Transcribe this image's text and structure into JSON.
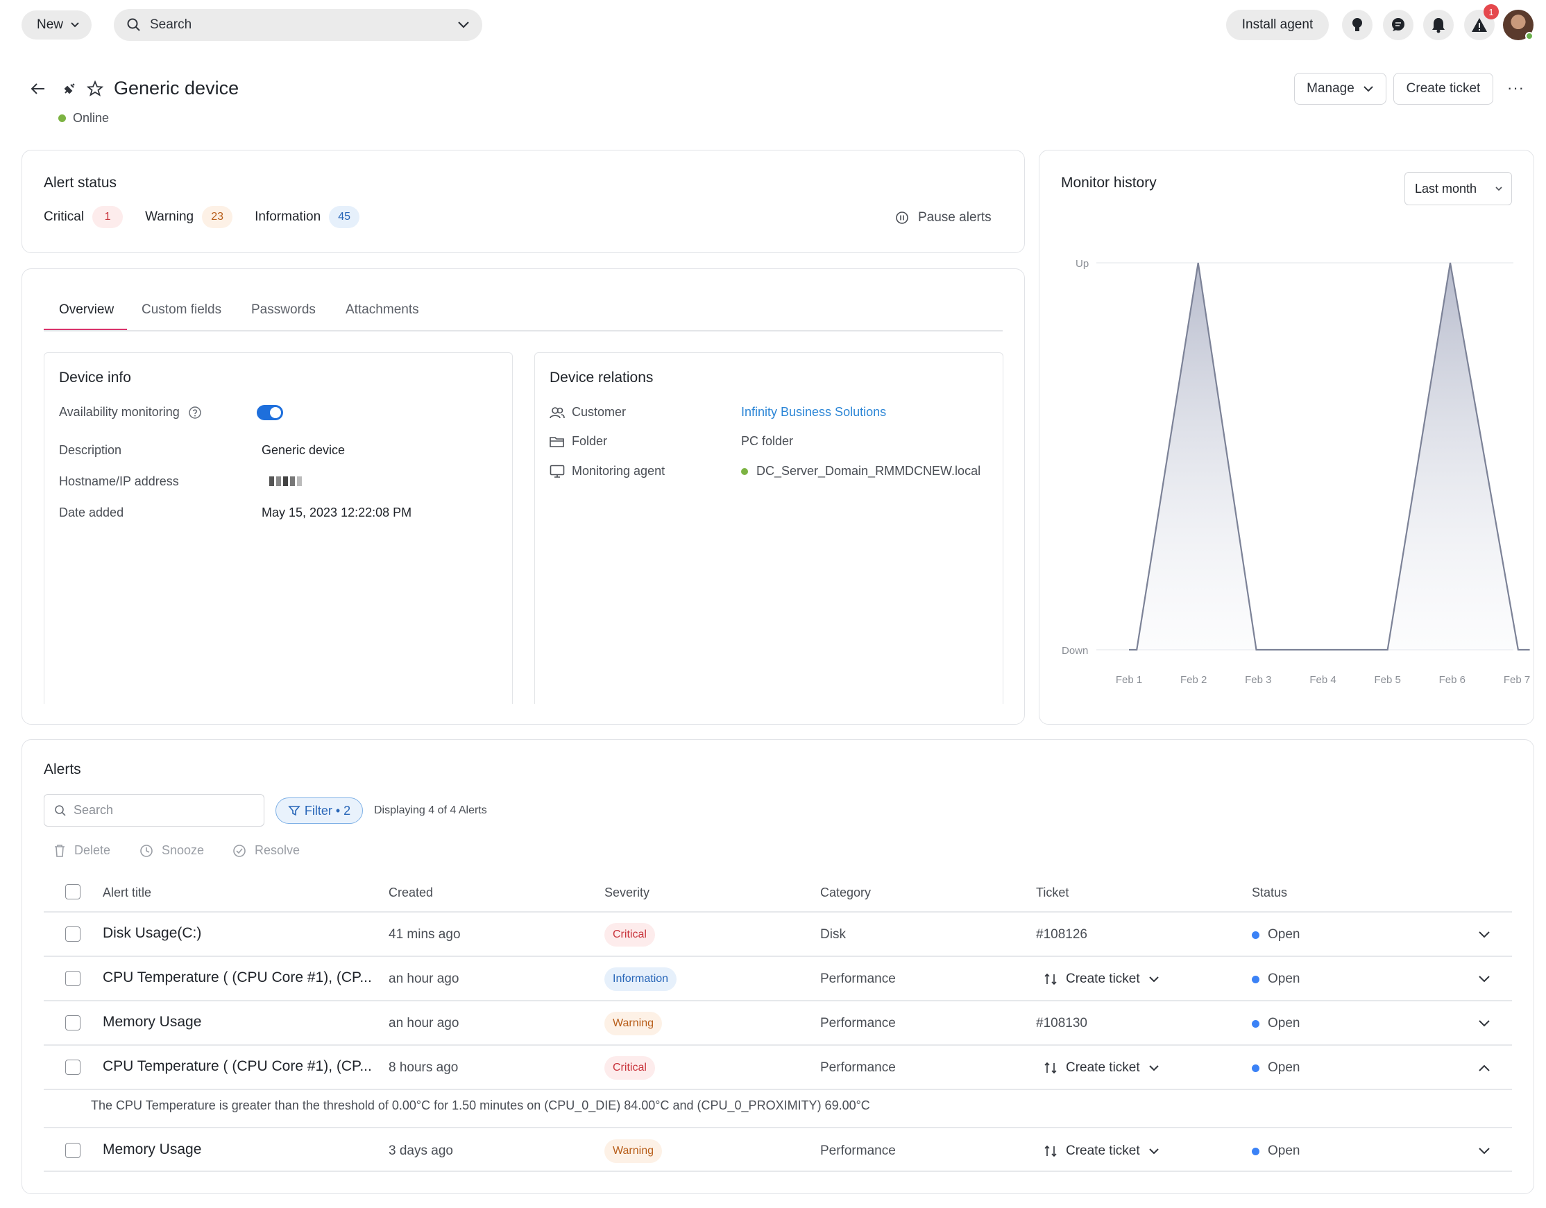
{
  "topbar": {
    "new_label": "New",
    "search_placeholder": "Search",
    "install_agent_label": "Install agent",
    "alerts_count": "1",
    "icons": [
      "lightbulb-icon",
      "chat-icon",
      "bell-icon",
      "warning-icon",
      "avatar"
    ]
  },
  "header": {
    "title": "Generic device",
    "status": "Online",
    "manage_label": "Manage",
    "create_ticket_label": "Create ticket"
  },
  "alert_status": {
    "title": "Alert status",
    "critical_label": "Critical",
    "critical_count": "1",
    "warning_label": "Warning",
    "warning_count": "23",
    "information_label": "Information",
    "information_count": "45",
    "pause_label": "Pause alerts"
  },
  "tabs": [
    "Overview",
    "Custom fields",
    "Passwords",
    "Attachments"
  ],
  "device_info": {
    "title": "Device info",
    "availability_label": "Availability monitoring",
    "availability_on": true,
    "description_label": "Description",
    "description_value": "Generic device",
    "hostname_label": "Hostname/IP address",
    "date_added_label": "Date added",
    "date_added_value": "May 15, 2023 12:22:08 PM"
  },
  "device_relations": {
    "title": "Device relations",
    "customer_label": "Customer",
    "customer_value": "Infinity Business Solutions",
    "folder_label": "Folder",
    "folder_value": "PC folder",
    "agent_label": "Monitoring agent",
    "agent_value": "DC_Server_Domain_RMMDCNEW.local"
  },
  "monitor_history": {
    "title": "Monitor history",
    "range_label": "Last month"
  },
  "chart_data": {
    "type": "area",
    "title": "Monitor history",
    "x": [
      "Feb 1",
      "Feb 2",
      "Feb 3",
      "Feb 4",
      "Feb 5",
      "Feb 6",
      "Feb 7"
    ],
    "y_ticks": [
      "Down",
      "Up"
    ],
    "points": [
      {
        "x": 0.0,
        "y": 0
      },
      {
        "x": 0.12,
        "y": 0
      },
      {
        "x": 1.07,
        "y": 1
      },
      {
        "x": 1.97,
        "y": 0
      },
      {
        "x": 4.0,
        "y": 0
      },
      {
        "x": 4.97,
        "y": 1
      },
      {
        "x": 6.02,
        "y": 0
      },
      {
        "x": 6.2,
        "y": 0
      }
    ],
    "series": [
      {
        "values": "Up/Down status"
      }
    ],
    "color": "#7c8297",
    "grid": true
  },
  "alerts": {
    "title": "Alerts",
    "search_placeholder": "Search",
    "filter_label": "Filter • 2",
    "displaying": "Displaying 4 of 4 Alerts",
    "actions": [
      "Delete",
      "Snooze",
      "Resolve"
    ],
    "columns": [
      "Alert title",
      "Created",
      "Severity",
      "Category",
      "Ticket",
      "Status"
    ],
    "rows": [
      {
        "title": "Disk Usage(C:)",
        "created": "41 mins ago",
        "severity": "Critical",
        "category": "Disk",
        "ticket": "#108126",
        "status": "Open"
      },
      {
        "title": "CPU Temperature ( (CPU Core #1), (CP...",
        "created": "an hour ago",
        "severity": "Information",
        "category": "Performance",
        "ticket": "Create ticket",
        "status": "Open"
      },
      {
        "title": "Memory Usage",
        "created": "an hour ago",
        "severity": "Warning",
        "category": "Performance",
        "ticket": "#108130",
        "status": "Open"
      },
      {
        "title": "CPU Temperature ( (CPU Core #1), (CP...",
        "created": "8 hours ago",
        "severity": "Critical",
        "category": "Performance",
        "ticket": "Create ticket",
        "status": "Open"
      },
      {
        "title": "Memory Usage",
        "created": "3 days ago",
        "severity": "Warning",
        "category": "Performance",
        "ticket": "Create ticket",
        "status": "Open"
      }
    ],
    "expanded_detail": "The CPU Temperature is greater than the threshold of 0.00°C for 1.50 minutes on (CPU_0_DIE) 84.00°C and (CPU_0_PROXIMITY) 69.00°C"
  },
  "colors": {
    "accent_pink": "#d8336b",
    "link_blue": "#2c86d6",
    "toggle_blue": "#1e6fdc",
    "online_green": "#7cb342",
    "open_blue": "#3b82f6"
  }
}
